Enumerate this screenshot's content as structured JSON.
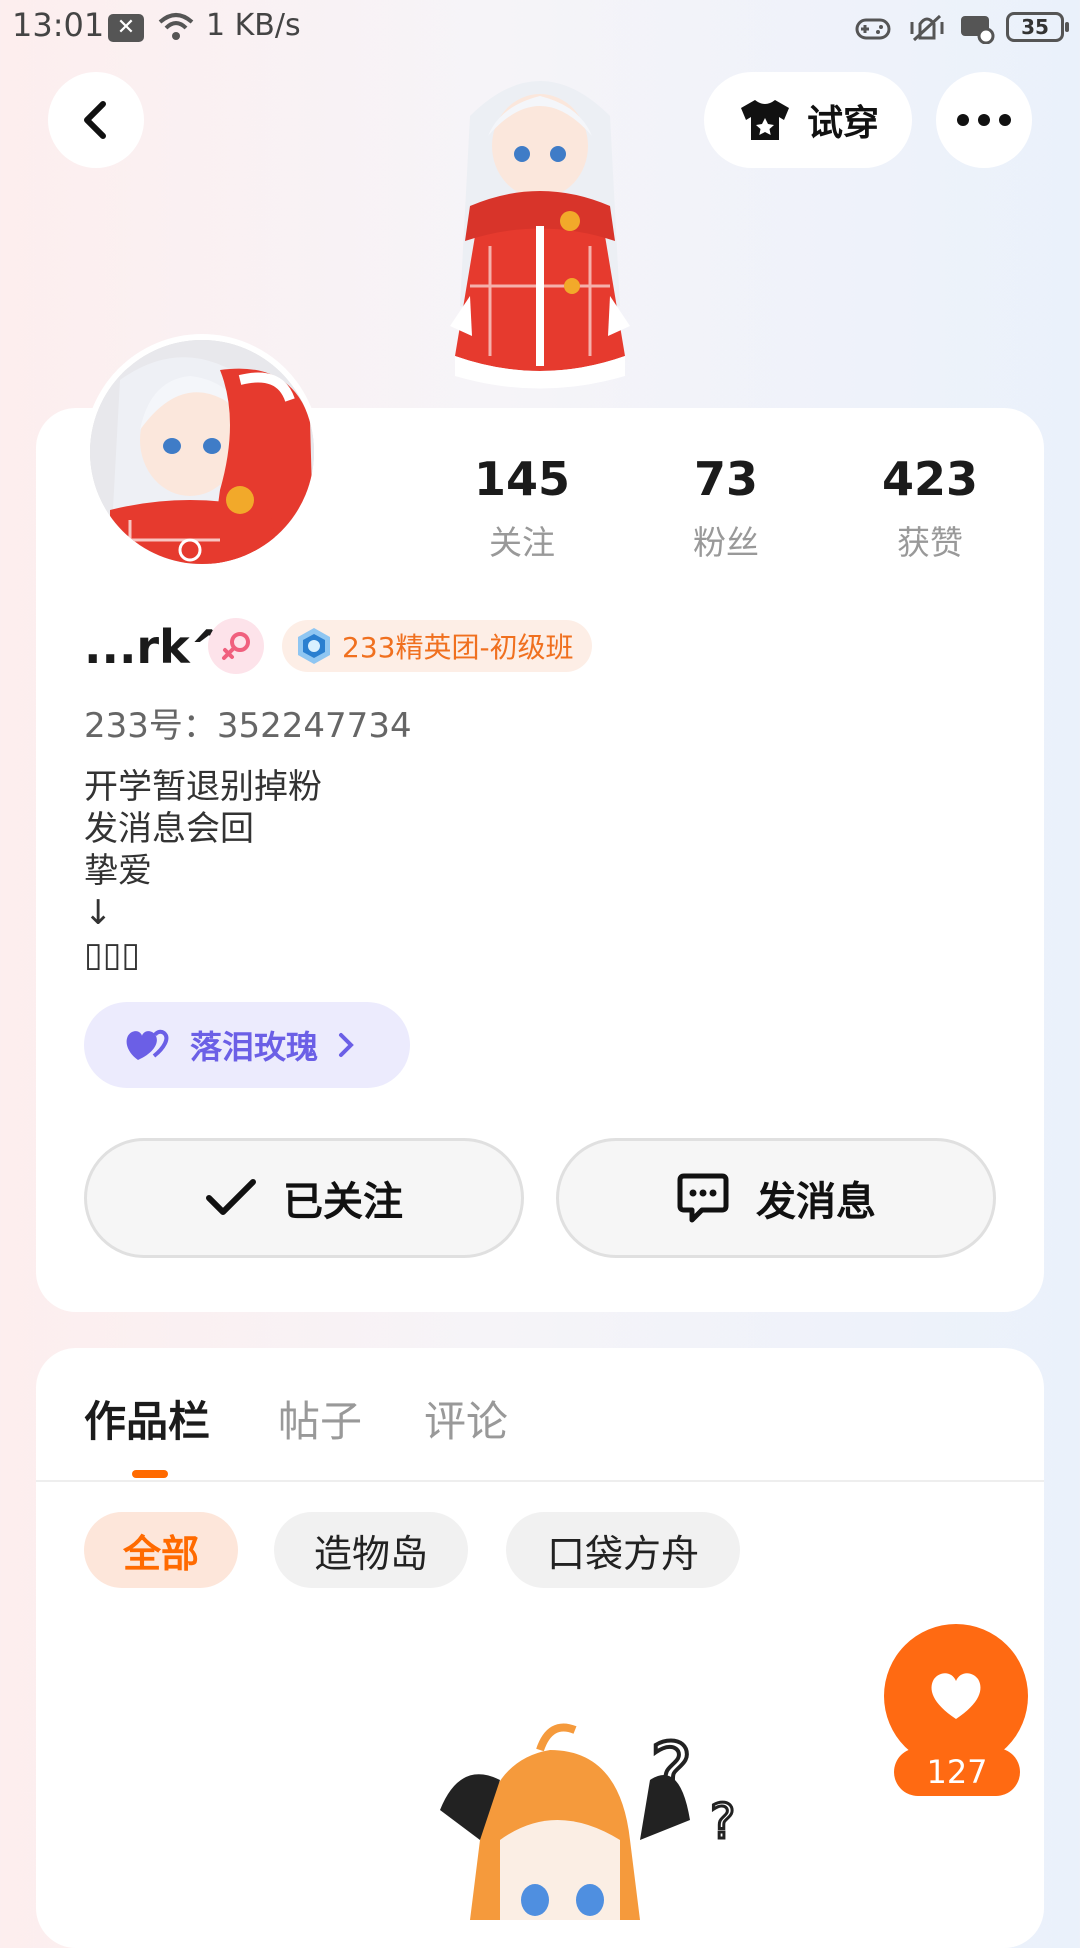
{
  "status_bar": {
    "time": "13:01",
    "speed": "1 KB/s",
    "battery": "35"
  },
  "top": {
    "try_on_label": "试穿"
  },
  "stats": [
    {
      "value": "145",
      "label": "关注"
    },
    {
      "value": "73",
      "label": "粉丝"
    },
    {
      "value": "423",
      "label": "获赞"
    }
  ],
  "profile": {
    "username": "...rk^",
    "badge": "233精英团-初级班",
    "uid": "233号：352247734",
    "bio": "开学暂退别掉粉\n发消息会回\n挚爱\n↓\n▯▯▯",
    "relation": "落泪玫瑰"
  },
  "actions": {
    "follow_label": "已关注",
    "message_label": "发消息"
  },
  "tabs": [
    "作品栏",
    "帖子",
    "评论"
  ],
  "filters": [
    "全部",
    "造物岛",
    "口袋方舟"
  ],
  "like_count": "127",
  "colors": {
    "accent": "#ff6a12",
    "relation": "#6b5fe6",
    "badge_text": "#f0701f"
  }
}
